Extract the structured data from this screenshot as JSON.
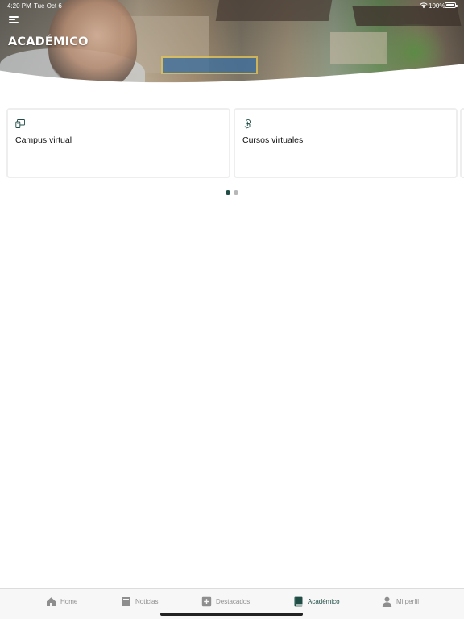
{
  "status_bar": {
    "time": "4:20 PM",
    "date": "Tue Oct 6",
    "battery": "100%",
    "battery_level": 1.0
  },
  "header": {
    "title": "ACADÉMICO",
    "menu_icon": "hamburger-menu-icon"
  },
  "cards": [
    {
      "label": "Campus virtual",
      "icon": "monitor-icon"
    },
    {
      "label": "Cursos virtuales",
      "icon": "touch-icon"
    }
  ],
  "pagination": {
    "pages": 2,
    "active": 1
  },
  "tab_bar": {
    "items": [
      {
        "label": "Home",
        "icon": "home-icon"
      },
      {
        "label": "Noticias",
        "icon": "newspaper-icon"
      },
      {
        "label": "Destacados",
        "icon": "plus-square-icon"
      },
      {
        "label": "Académico",
        "icon": "book-icon",
        "active": true
      },
      {
        "label": "Mi perfil",
        "icon": "user-icon"
      }
    ]
  },
  "colors": {
    "accent": "#1f4d45",
    "inactive": "#8e8e8e",
    "card_border": "#eeeeee",
    "tab_bar_bg": "#f7f7f7"
  }
}
